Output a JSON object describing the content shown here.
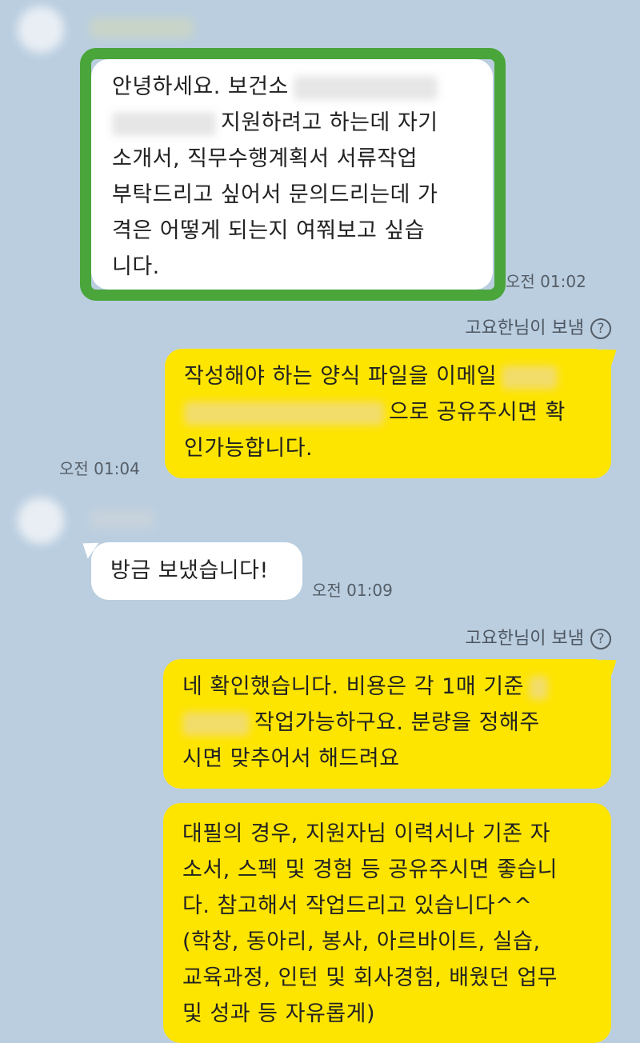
{
  "messages": {
    "m1": {
      "lines": [
        "안녕하세요. 보건소",
        "지원하려고 하는데 자기",
        "소개서, 직무수행계획서 서류작업",
        "부탁드리고 싶어서 문의드리는데 가",
        "격은 어떻게 되는지 여쭤보고 싶습",
        "니다."
      ],
      "time": "오전 01:02"
    },
    "m2": {
      "sender": "고요한님이 보냄",
      "lines": [
        "작성해야 하는 양식 파일을 이메일",
        "으로 공유주시면 확",
        "인가능합니다."
      ],
      "time": "오전 01:04"
    },
    "m3": {
      "lines": [
        "방금 보냈습니다!"
      ],
      "time": "오전 01:09"
    },
    "m4": {
      "sender": "고요한님이 보냄",
      "lines": [
        "네 확인했습니다. 비용은 각 1매 기준",
        "작업가능하구요. 분량을 정해주",
        "시면 맞추어서 해드려요"
      ]
    },
    "m5": {
      "lines": [
        "대필의 경우, 지원자님 이력서나 기존 자",
        "소서, 스펙 및 경험 등 공유주시면 좋습니",
        "다. 참고해서 작업드리고 있습니다^^",
        "(학창, 동아리, 봉사, 아르바이트, 실습,",
        "교육과정, 인턴 및 회사경험, 배웠던 업무",
        "및 성과 등 자유롭게)"
      ]
    }
  },
  "icons": {
    "help": "?"
  },
  "colors": {
    "background": "#bacee0",
    "sent_bubble": "#fee500",
    "received_bubble": "#ffffff",
    "highlight_border": "#4aa53a"
  }
}
